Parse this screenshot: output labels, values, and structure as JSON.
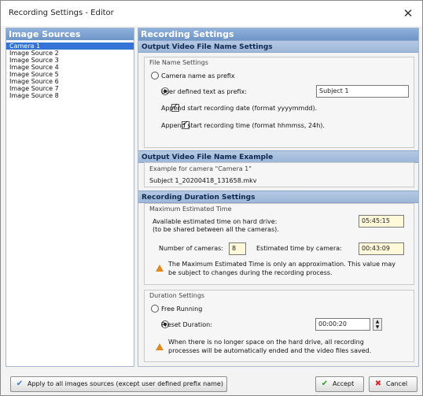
{
  "window": {
    "title": "Recording Settings - Editor",
    "close_icon": "close-icon"
  },
  "left": {
    "header": "Image Sources",
    "items": [
      "Camera 1",
      "Image Source 2",
      "Image Source 3",
      "Image Source 4",
      "Image Source 5",
      "Image Source 6",
      "Image Source 7",
      "Image Source 8"
    ],
    "selected_index": 0
  },
  "right": {
    "header": "Recording Settings",
    "output_name": {
      "title": "Output Video File Name Settings",
      "group_title": "File Name Settings",
      "opt_camera": "Camera name as prefix",
      "opt_user": "User defined text as prefix:",
      "prefix_value": "Subject 1",
      "chk_date": "Append start recording date (format yyyymmdd).",
      "chk_time": "Append start recording time (format hhmmss, 24h).",
      "selected_option": "user",
      "date_checked": true,
      "time_checked": true
    },
    "example": {
      "title": "Output Video File Name Example",
      "line1": "Example for camera \"Camera 1\"",
      "line2": "Subject 1_20200418_131658.mkv"
    },
    "duration": {
      "title": "Recording Duration Settings",
      "max_group_title": "Maximum Estimated Time",
      "available_line1": "Available estimated time on hard drive:",
      "available_line2": "(to be shared between all the cameras).",
      "available_value": "05:45:15",
      "num_cameras_label": "Number of cameras:",
      "num_cameras_value": "8",
      "est_by_camera_label": "Estimated time by camera:",
      "est_by_camera_value": "00:43:09",
      "note_line1": "The Maximum Estimated Time is only an approximation. This value may",
      "note_line2": "be subject to changes during the recording process.",
      "duration_group_title": "Duration Settings",
      "opt_free": "Free Running",
      "opt_preset": "Preset Duration:",
      "preset_value": "00:00:20",
      "selected_option": "preset",
      "warn_line1": "When there is no longer space on the hard drive, all recording",
      "warn_line2": "processes will be automatically ended and the video files saved."
    }
  },
  "footer": {
    "apply_label": "Apply to all images sources (except user defined prefix name)",
    "accept_label": "Accept",
    "cancel_label": "Cancel"
  }
}
